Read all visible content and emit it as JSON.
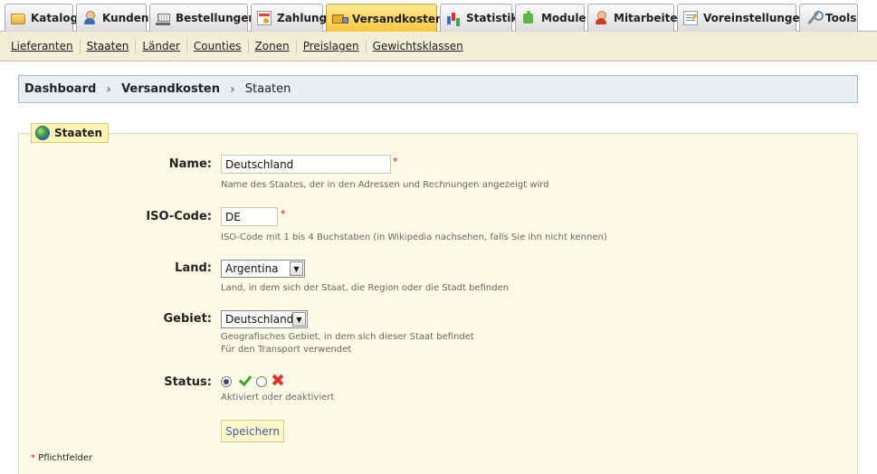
{
  "tabs": [
    {
      "label": "Katalog",
      "icon": "folder-icon",
      "active": false
    },
    {
      "label": "Kunden",
      "icon": "user-icon",
      "active": false
    },
    {
      "label": "Bestellungen",
      "icon": "cart-icon",
      "active": false
    },
    {
      "label": "Zahlung",
      "icon": "payment-icon",
      "active": false
    },
    {
      "label": "Versandkosten",
      "icon": "truck-icon",
      "active": true
    },
    {
      "label": "Statistik",
      "icon": "stats-icon",
      "active": false
    },
    {
      "label": "Module",
      "icon": "module-icon",
      "active": false
    },
    {
      "label": "Mitarbeiter",
      "icon": "employee-icon",
      "active": false
    },
    {
      "label": "Voreinstellungen",
      "icon": "preferences-icon",
      "active": false
    },
    {
      "label": "Tools",
      "icon": "tools-icon",
      "active": false
    }
  ],
  "subnav": [
    "Lieferanten",
    "Staaten",
    "Länder",
    "Counties",
    "Zonen",
    "Preislagen",
    "Gewichtsklassen"
  ],
  "breadcrumb": {
    "root": "Dashboard",
    "section": "Versandkosten",
    "current": "Staaten"
  },
  "form": {
    "legend": "Staaten",
    "name": {
      "label": "Name:",
      "value": "Deutschland",
      "required": "*",
      "hint": "Name des Staates, der in den Adressen und Rechnungen angezeigt wird"
    },
    "iso": {
      "label": "ISO-Code:",
      "value": "DE",
      "required": "*",
      "hint": "ISO-Code mit 1 bis 4 Buchstaben (in Wikipedia nachsehen, falls Sie ihn nicht kennen)"
    },
    "country": {
      "label": "Land:",
      "value": "Argentina",
      "hint": "Land, in dem sich der Staat, die Region oder die Stadt befinden"
    },
    "zone": {
      "label": "Gebiet:",
      "value": "Deutschland",
      "hint1": "Geografisches Gebiet, in dem sich dieser Staat befindet",
      "hint2": "Für den Transport verwendet"
    },
    "status": {
      "label": "Status:",
      "selected": "enabled",
      "hint": "Aktiviert oder deaktiviert"
    },
    "save": "Speichern",
    "footnote_star": "*",
    "footnote": "Pflichtfelder"
  },
  "colors": {
    "active_tab": "#f8c53c",
    "panel_bg": "#fbfbe6",
    "required": "#cc1111",
    "enabled": "#3aa52a",
    "disabled": "#e0322c"
  }
}
